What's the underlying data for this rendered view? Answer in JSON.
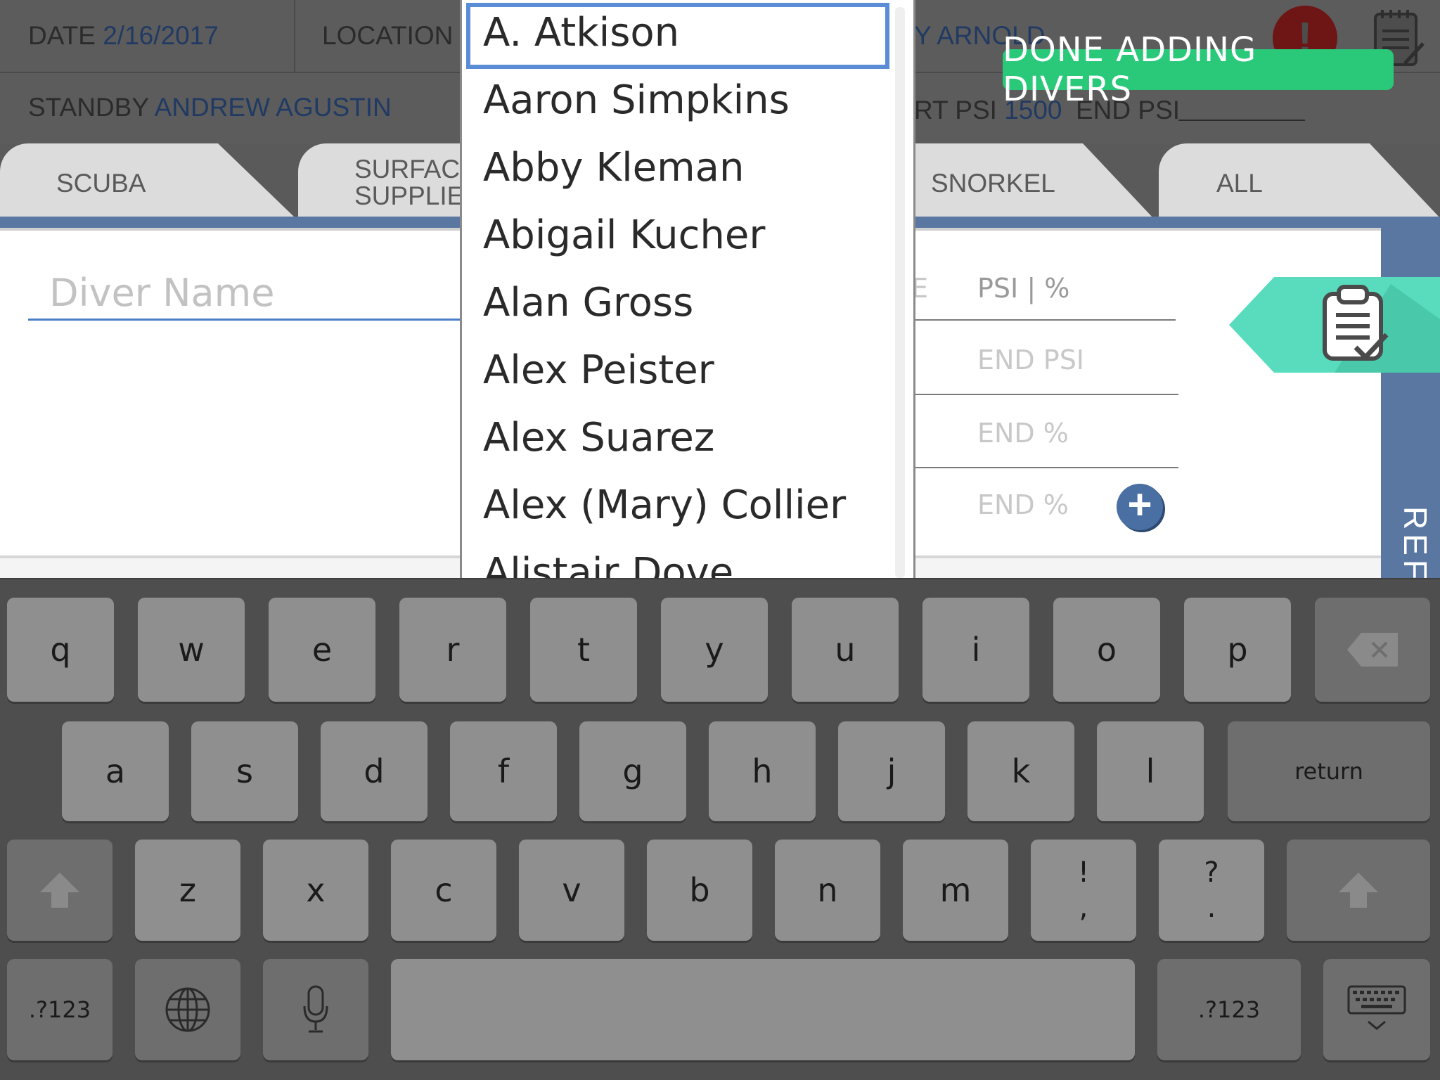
{
  "header": {
    "date_label": "DATE",
    "date_value": "2/16/2017",
    "location_label": "LOCATION",
    "partial_name": "Y ARNOLD",
    "standby_label": "STANDBY",
    "standby_value": "ANDREW AGUSTIN",
    "start_psi_label": "RT PSI",
    "start_psi_value": "1500",
    "end_psi_label": "END PSI",
    "alert_symbol": "!",
    "done_button": "DONE ADDING DIVERS"
  },
  "tabs": [
    {
      "label": "SCUBA"
    },
    {
      "label": "SURFACE SUPPLIED",
      "line1": "SURFAC",
      "line2": "SUPPLIE"
    },
    {
      "label": "SNORKEL"
    },
    {
      "label": "ALL"
    }
  ],
  "form": {
    "diver_placeholder": "Diver Name",
    "psi_header": "PSI  |  %",
    "end_psi_placeholder": "END PSI",
    "end_pct_placeholder_1": "END %",
    "end_pct_placeholder_2": "END %",
    "partial_col": "E",
    "add_symbol": "+"
  },
  "side": {
    "refill_partial": "REFI"
  },
  "dropdown": {
    "items": [
      "A. Atkison",
      "Aaron Simpkins",
      "Abby Kleman",
      "Abigail Kucher",
      "Alan Gross",
      "Alex Peister",
      "Alex Suarez",
      "Alex (Mary) Collier",
      "Alistair Dove"
    ],
    "selected_index": 0
  },
  "keyboard": {
    "row1": [
      "q",
      "w",
      "e",
      "r",
      "t",
      "y",
      "u",
      "i",
      "o",
      "p"
    ],
    "row2": [
      "a",
      "s",
      "d",
      "f",
      "g",
      "h",
      "j",
      "k",
      "l"
    ],
    "row3": [
      "z",
      "x",
      "c",
      "v",
      "b",
      "n",
      "m"
    ],
    "return_label": "return",
    "punct1_top": "!",
    "punct1_bottom": ",",
    "punct2_top": "?",
    "punct2_bottom": ".",
    "numbers_label": ".?123",
    "numbers_label_right": ".?123",
    "icons": [
      "backspace-icon",
      "shift-icon",
      "globe-icon",
      "microphone-icon",
      "keyboard-dismiss-icon"
    ]
  },
  "colors": {
    "accent_blue": "#5a77a2",
    "done_green": "#2ac97a",
    "tag_teal": "#58dcbd",
    "selection_blue": "#5b8dd6"
  }
}
